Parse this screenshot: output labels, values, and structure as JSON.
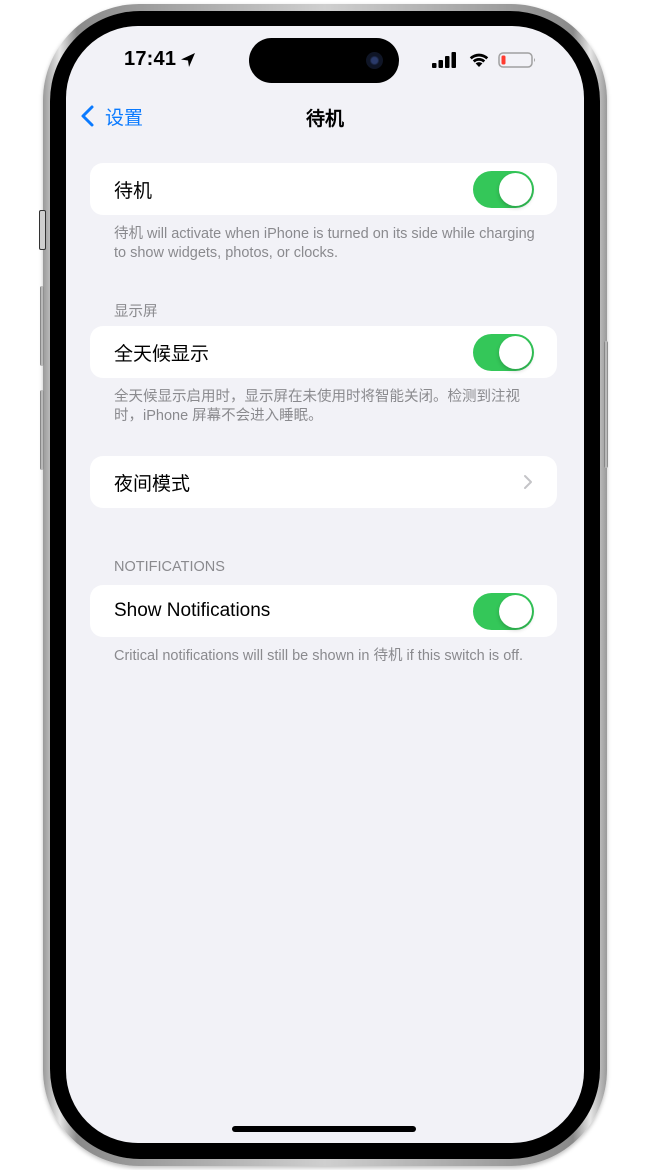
{
  "status_bar": {
    "time": "17:41",
    "location_icon": "location-arrow-icon",
    "signal_icon": "cellular-signal-icon",
    "wifi_icon": "wifi-icon",
    "battery_icon": "battery-low-icon",
    "battery_level_percent": 10,
    "battery_color": "#ff3b30"
  },
  "nav": {
    "back_label": "设置",
    "back_icon": "chevron-left-icon",
    "title": "待机"
  },
  "colors": {
    "accent": "#0a7aff",
    "toggle_on": "#34c759",
    "background": "#f2f2f7"
  },
  "sections": [
    {
      "header": "",
      "rows": [
        {
          "label": "待机",
          "type": "toggle",
          "value": true
        }
      ],
      "footer": "待机 will activate when iPhone is turned on its side while charging to show widgets, photos, or clocks."
    },
    {
      "header": "显示屏",
      "rows": [
        {
          "label": "全天候显示",
          "type": "toggle",
          "value": true
        }
      ],
      "footer": "全天候显示启用时，显示屏在未使用时将智能关闭。检测到注视时，iPhone 屏幕不会进入睡眠。"
    },
    {
      "header": "",
      "rows": [
        {
          "label": "夜间模式",
          "type": "disclosure",
          "icon": "chevron-right-icon"
        }
      ],
      "footer": ""
    },
    {
      "header": "NOTIFICATIONS",
      "rows": [
        {
          "label": "Show Notifications",
          "type": "toggle",
          "value": true
        }
      ],
      "footer": "Critical notifications will still be shown in 待机 if this switch is off."
    }
  ]
}
